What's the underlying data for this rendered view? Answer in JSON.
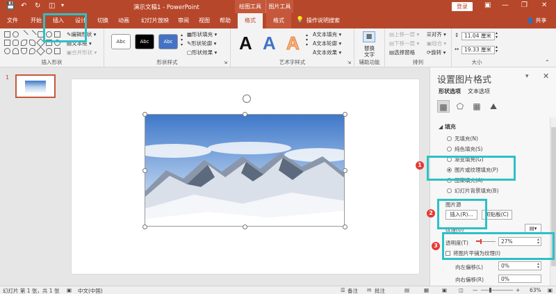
{
  "app": {
    "title": "演示文稿1 - PowerPoint",
    "context_tabs": [
      "绘图工具",
      "图片工具"
    ],
    "login_label": "登录",
    "share_label": "共享"
  },
  "tabs": [
    "文件",
    "开始",
    "插入",
    "设计",
    "切换",
    "动画",
    "幻灯片放映",
    "审阅",
    "视图",
    "帮助",
    "格式",
    "格式"
  ],
  "tell_me": "操作说明搜索",
  "ribbon": {
    "insert_shapes": {
      "label": "插入形状",
      "edit_shape": "编辑形状",
      "text_box": "文本框",
      "merge_shapes": "合并形状"
    },
    "shape_styles": {
      "label": "形状样式",
      "style_sample": "Abc",
      "fill": "形状填充",
      "outline": "形状轮廓",
      "effects": "形状效果"
    },
    "wordart": {
      "label": "艺术字样式",
      "letter": "A",
      "text_fill": "文本填充",
      "text_outline": "文本轮廓",
      "text_effects": "文本效果"
    },
    "accessibility": {
      "label": "辅助功能",
      "alt_text_1": "替换",
      "alt_text_2": "文字"
    },
    "arrange": {
      "label": "排列",
      "bring_forward": "上移一层",
      "send_backward": "下移一层",
      "selection_pane": "选择窗格",
      "align": "对齐",
      "group": "组合",
      "rotate": "旋转"
    },
    "size": {
      "label": "大小",
      "height": "11.04 厘米",
      "width": "19.33 厘米"
    }
  },
  "thumbnails": {
    "slide_number": "1"
  },
  "format_pane": {
    "title": "设置图片格式",
    "tabs": [
      "形状选项",
      "文本选项"
    ],
    "section_fill": "填充",
    "fill_options": [
      "无填充(N)",
      "纯色填充(S)",
      "渐变填充(G)",
      "图片或纹理填充(P)",
      "图案填充(A)",
      "幻灯片背景填充(B)"
    ],
    "picture_source_label": "图片源",
    "insert_button": "插入(R)...",
    "clipboard_button": "剪贴板(C)",
    "texture_label": "纹理(U)",
    "transparency_label": "透明度(T)",
    "transparency_value": "27%",
    "transparency_fraction": 0.27,
    "tile_label": "将图片平铺为纹理(I)",
    "offset_left_label": "向左偏移(L)",
    "offset_left_value": "0%",
    "offset_right_label": "向右偏移(R)",
    "offset_right_value": "0%"
  },
  "annotations": [
    "1",
    "2",
    "3"
  ],
  "status": {
    "slide_info": "幻灯片 第 1 张，共 1 张",
    "language": "中文(中国)",
    "notes": "批注",
    "zoom": "63%"
  },
  "colors": {
    "accent": "#b7472a",
    "highlight": "#2bc1c7",
    "badge": "#e53935"
  }
}
